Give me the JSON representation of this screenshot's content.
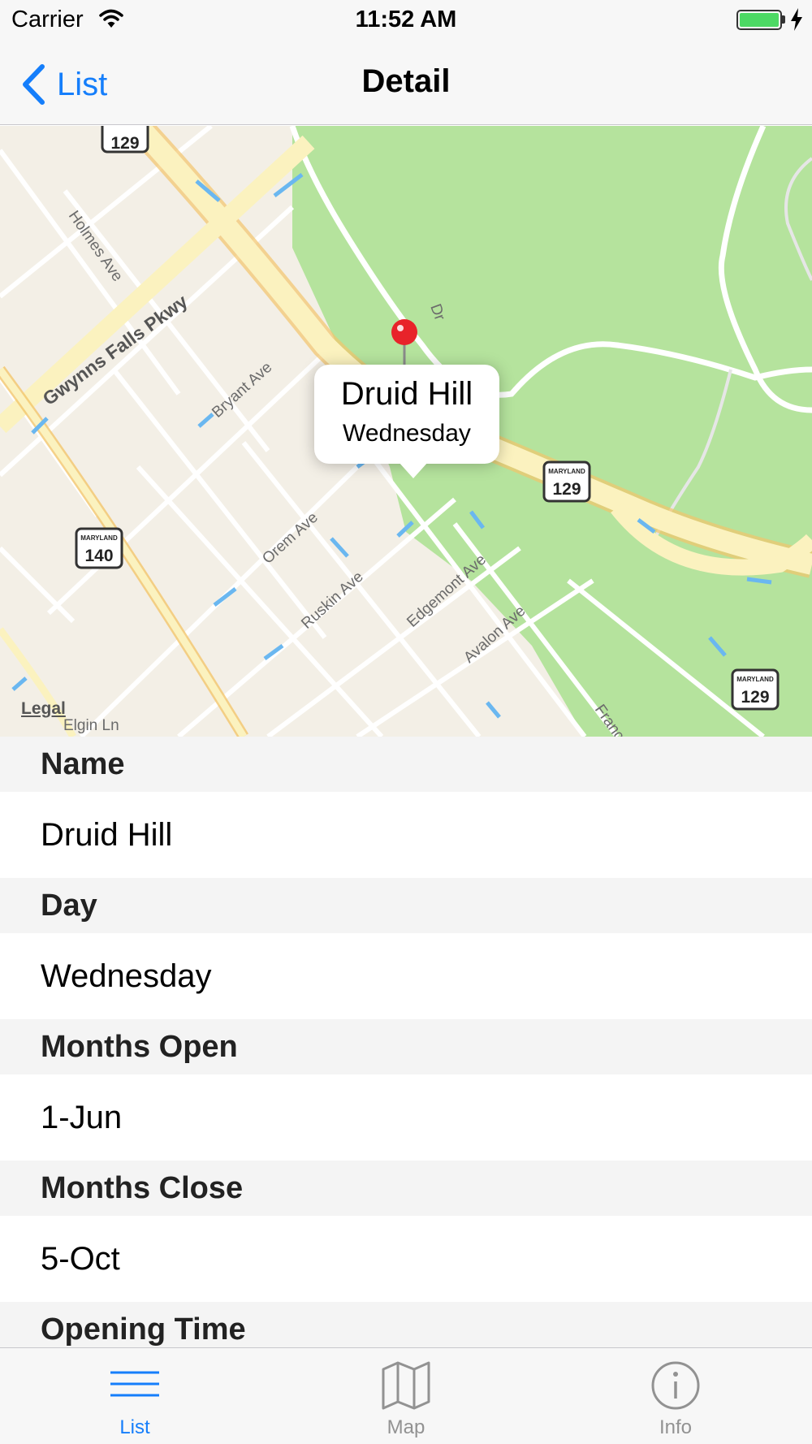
{
  "status_bar": {
    "carrier": "Carrier",
    "time": "11:52 AM",
    "battery_color": "#4cd964"
  },
  "nav": {
    "back_label": "List",
    "title": "Detail",
    "accent_color": "#157efb"
  },
  "map": {
    "callout": {
      "title": "Druid Hill",
      "subtitle": "Wednesday"
    },
    "legal": "Legal",
    "street_labels": [
      "Holmes Ave",
      "Gwynns Falls Pkwy",
      "Bryant Ave",
      "Orem Ave",
      "Ruskin Ave",
      "Edgemont Ave",
      "Avalon Ave",
      "Elgin Ln",
      "Franc",
      "Dr"
    ],
    "shields": [
      {
        "state": "MARYLAND",
        "number": "129"
      },
      {
        "state": "MARYLAND",
        "number": "140"
      },
      {
        "state": "MARYLAND",
        "number": "129"
      },
      {
        "state": "MARYLAND",
        "number": "129"
      }
    ],
    "pin_color": "#e8232a",
    "park_color": "#b5e39d"
  },
  "details": [
    {
      "header": "Name",
      "value": "Druid Hill"
    },
    {
      "header": "Day",
      "value": "Wednesday"
    },
    {
      "header": "Months Open",
      "value": "1-Jun"
    },
    {
      "header": "Months Close",
      "value": "5-Oct"
    },
    {
      "header": "Opening Time",
      "value": ""
    }
  ],
  "tabs": [
    {
      "label": "List",
      "icon": "list-icon",
      "selected": true
    },
    {
      "label": "Map",
      "icon": "map-icon",
      "selected": false
    },
    {
      "label": "Info",
      "icon": "info-icon",
      "selected": false
    }
  ],
  "tab_colors": {
    "selected": "#157efb",
    "unselected": "#929292"
  }
}
